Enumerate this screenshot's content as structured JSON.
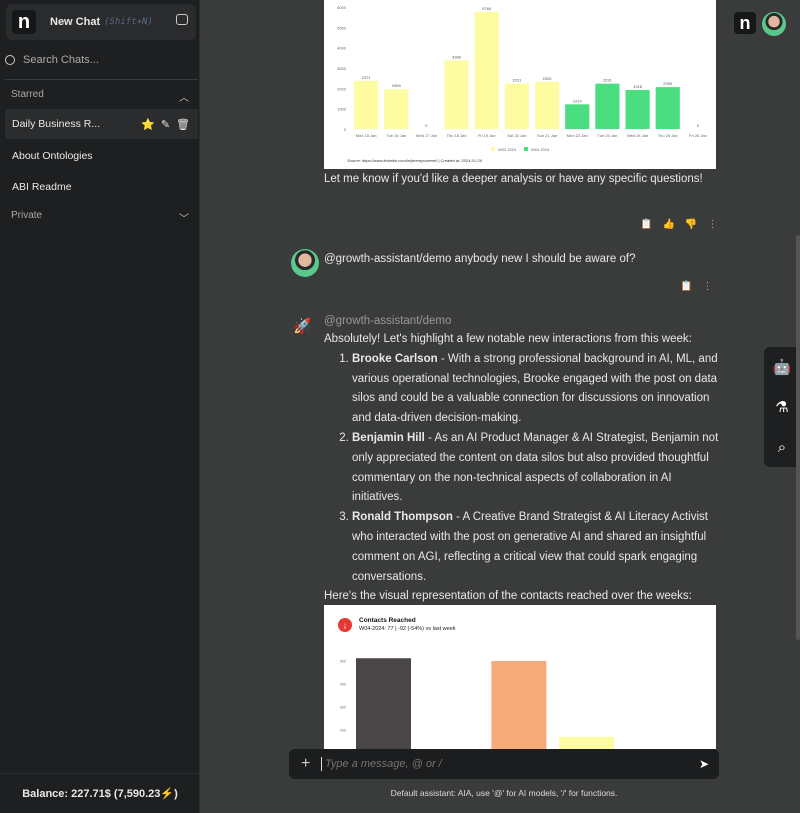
{
  "sidebar": {
    "new_chat": "New Chat",
    "shortcut": "(Shift+N)",
    "search_placeholder": "Search Chats...",
    "starred": "Starred",
    "private": "Private",
    "items": [
      {
        "label": "Daily Business R..."
      },
      {
        "label": "About Ontologies"
      },
      {
        "label": "ABI Readme"
      }
    ],
    "balance": "Balance: 227.71$ (7,590.23⚡)"
  },
  "messages": {
    "m1_text": "Let me know if you'd like a deeper analysis or have any specific questions!",
    "user_text": "@growth-assistant/demo anybody new I should be aware of?",
    "assistant_name": "@growth-assistant/demo",
    "intro": "Absolutely! Let's highlight a few notable new interactions from this week:",
    "list": [
      {
        "name": "Brooke Carlson",
        "text": " - With a strong professional background in AI, ML, and various operational technologies, Brooke engaged with the post on data silos and could be a valuable connection for discussions on innovation and data-driven decision-making."
      },
      {
        "name": "Benjamin Hill",
        "text": " - As an AI Product Manager & AI Strategist, Benjamin not only appreciated the content on data silos but also provided thoughtful commentary on the non-technical aspects of collaboration in AI initiatives."
      },
      {
        "name": "Ronald Thompson",
        "text": " - A Creative Brand Strategist & AI Literacy Activist who interacted with the post on generative AI and shared an insightful comment on AGI, reflecting a critical view that could spark engaging conversations."
      }
    ],
    "outro": "Here's the visual representation of the contacts reached over the weeks:"
  },
  "composer": {
    "placeholder": "Type a message, @ or /",
    "footnote": "Default assistant: AIA, use '@' for AI models, '/' for functions."
  },
  "chart_data": [
    {
      "type": "bar",
      "categories": [
        "Mon 15 Jan",
        "Tue 16 Jan",
        "Wed 17 Jan",
        "Thu 18 Jan",
        "Fri 19 Jan",
        "Sat 20 Jan",
        "Sun 21 Jan",
        "Mon 22 Jan",
        "Tue 23 Jan",
        "Wed 24 Jan",
        "Thu 25 Jan",
        "Fri 26 Jan"
      ],
      "series": [
        {
          "name": "W03 2024",
          "color": "#fdfca0",
          "values": [
            2371,
            1959,
            0,
            3369,
            5760,
            2231,
            2320,
            null,
            null,
            null,
            null,
            null
          ]
        },
        {
          "name": "W04 2024",
          "color": "#4ade80",
          "values": [
            null,
            null,
            null,
            null,
            null,
            null,
            null,
            1214,
            2231,
            1918,
            2059,
            0
          ]
        }
      ],
      "ylim": [
        0,
        6000
      ],
      "yticks": [
        0,
        1000,
        2000,
        3000,
        4000,
        5000,
        6000
      ],
      "legend": "bottom",
      "source": "Source: https://www.linkedin.com/in/jeremyravenel/ | Created at: 2024-01-26"
    },
    {
      "type": "bar",
      "title": "Contacts Reached",
      "subtitle": "W04-2024: 77 | -92 (-54%) vs last week",
      "values": [
        512,
        0,
        500,
        170,
        5
      ],
      "colors": [
        "#4a4547",
        "#ffffff",
        "#f6ab78",
        "#fdfca0",
        "#4ade80"
      ],
      "yticks": [
        100,
        200,
        300,
        400,
        500
      ]
    }
  ]
}
